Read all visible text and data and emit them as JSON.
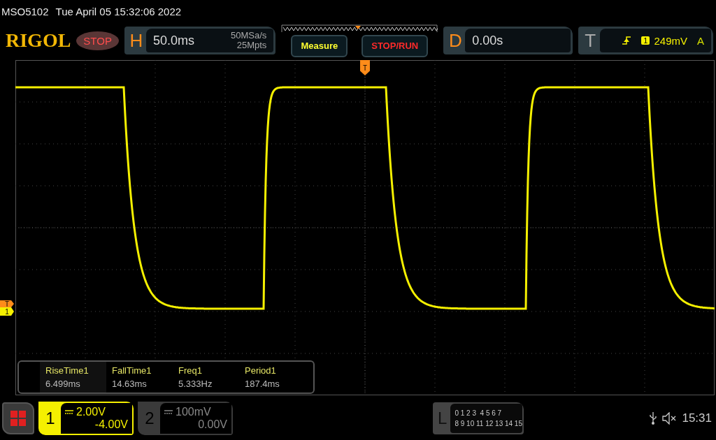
{
  "header": {
    "model": "MSO5102",
    "datetime": "Tue April 05 15:32:06 2022"
  },
  "toolbar": {
    "logo": "RIGOL",
    "run_state": "STOP",
    "horizontal": {
      "label": "H",
      "timebase": "50.0ms",
      "sample_rate": "50MSa/s",
      "memory_depth": "25Mpts"
    },
    "buttons": [
      {
        "label": "Measure",
        "kind": "measure"
      },
      {
        "label": "STOP/RUN",
        "kind": "run"
      }
    ],
    "delay": {
      "label": "D",
      "value": "0.00s"
    },
    "trigger": {
      "label": "T",
      "source": "1",
      "level": "249mV",
      "mode": "A"
    }
  },
  "display": {
    "trigger_position_marker": "T",
    "trigger_level_marker": "T",
    "channel_marker": "1"
  },
  "measurements": [
    {
      "name": "RiseTime1",
      "value": "6.499ms",
      "selected": true
    },
    {
      "name": "FallTime1",
      "value": "14.63ms",
      "selected": false
    },
    {
      "name": "Freq1",
      "value": "5.333Hz",
      "selected": false
    },
    {
      "name": "Period1",
      "value": "187.4ms",
      "selected": false
    }
  ],
  "channels": [
    {
      "number": "1",
      "scale": "2.00V",
      "offset": "-4.00V",
      "selected": true
    },
    {
      "number": "2",
      "scale": "100mV",
      "offset": "0.00V",
      "selected": false
    }
  ],
  "logic": {
    "label": "L",
    "rows": [
      "0 1 2 3  4 5 6 7",
      "8 9 10 11 12 13 14 15"
    ]
  },
  "status": {
    "time": "15:31"
  }
}
